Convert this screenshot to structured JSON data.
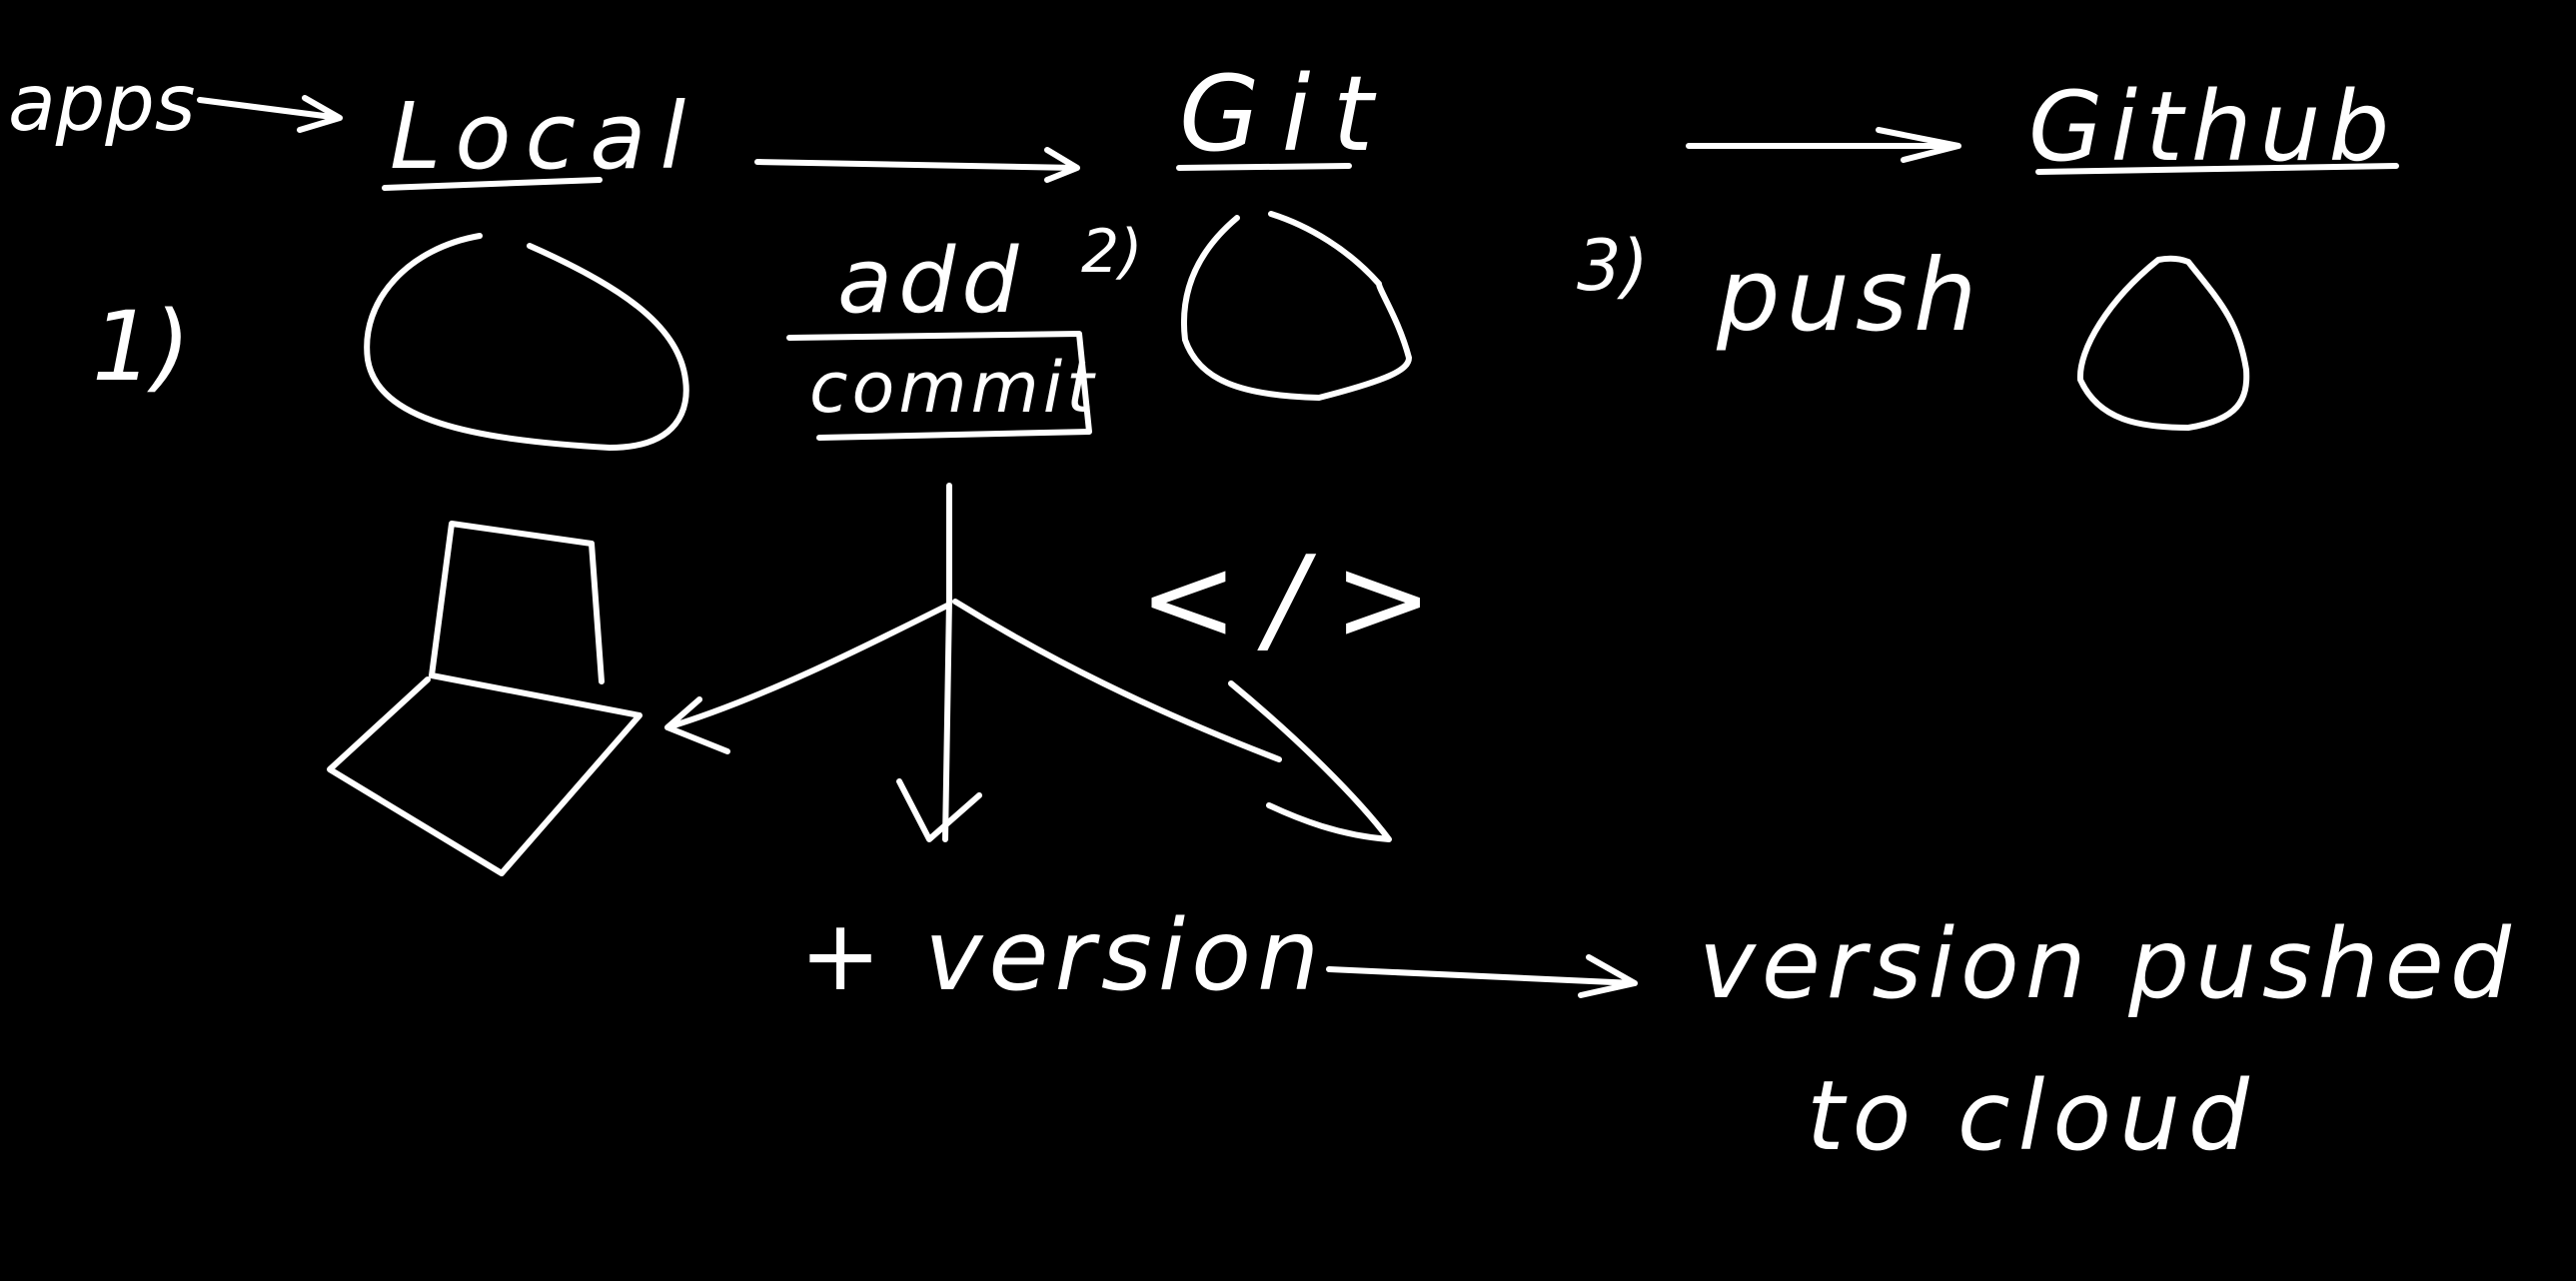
{
  "board": {
    "background_color": "#000000",
    "ink_color": "#ffffff"
  },
  "labels": {
    "apps": "apps",
    "local": "Local",
    "git": "Git",
    "github": "Github",
    "step_1": "1)",
    "step_2": "2)",
    "step_3": "3)",
    "add": "add",
    "commit": "commit",
    "push": "push",
    "code_tag": "</>",
    "plus_version": "+ version",
    "version_pushed_line1": "version pushed",
    "version_pushed_line2": "to cloud"
  },
  "icons": {
    "local_circle": "circle-sketch",
    "git_circle": "circle-sketch",
    "github_circle": "circle-sketch",
    "laptop": "laptop-sketch"
  }
}
